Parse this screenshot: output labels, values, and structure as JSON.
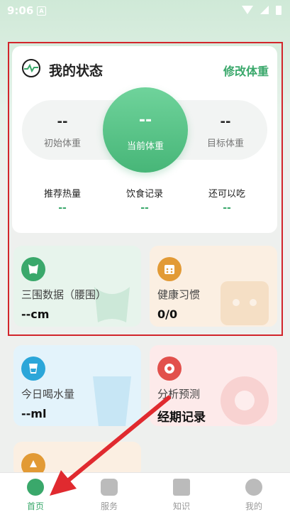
{
  "status_bar": {
    "time": "9:06",
    "notification_icon": "A"
  },
  "status_card": {
    "title": "我的状态",
    "edit_weight": "修改体重",
    "initial_weight": {
      "value": "--",
      "label": "初始体重"
    },
    "current_weight": {
      "value": "--",
      "label": "当前体重"
    },
    "target_weight": {
      "value": "--",
      "label": "目标体重"
    },
    "stats": [
      {
        "label": "推荐热量",
        "value": "--"
      },
      {
        "label": "饮食记录",
        "value": "--"
      },
      {
        "label": "还可以吃",
        "value": "--"
      }
    ]
  },
  "tiles": {
    "measurements": {
      "label": "三围数据（腰围）",
      "value": "--cm"
    },
    "habits": {
      "label": "健康习惯",
      "value": "0/0"
    },
    "water": {
      "label": "今日喝水量",
      "value": "--ml"
    },
    "prediction": {
      "label": "分析预测",
      "value": "经期记录"
    }
  },
  "tabs": [
    {
      "label": "首页",
      "active": true
    },
    {
      "label": "服务",
      "active": false
    },
    {
      "label": "知识",
      "active": false
    },
    {
      "label": "我的",
      "active": false
    }
  ],
  "colors": {
    "accent": "#3aa86b",
    "highlight": "#d2252b",
    "arrow": "#e02a2f"
  }
}
